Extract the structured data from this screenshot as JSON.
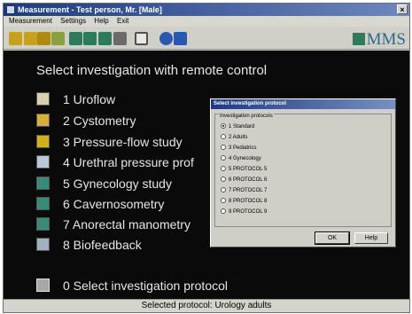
{
  "window": {
    "title": "Measurement - Test person, Mr. [Male]",
    "close_glyph": "×"
  },
  "menu": [
    "Measurement",
    "Settings",
    "Help",
    "Exit"
  ],
  "toolbar": {
    "icons": [
      {
        "name": "uroflow-tool-icon",
        "color": "#c8a020"
      },
      {
        "name": "cystometry-tool-icon",
        "color": "#c8a020"
      },
      {
        "name": "pressure-flow-tool-icon",
        "color": "#b08a10"
      },
      {
        "name": "urethral-tool-icon",
        "color": "#8aa040"
      },
      {
        "name": "gynecology-tool-icon",
        "color": "#2e7a5c"
      },
      {
        "name": "cavernosometry-tool-icon",
        "color": "#2e7a5c"
      },
      {
        "name": "anorectal-tool-icon",
        "color": "#2e7a5c"
      },
      {
        "name": "biofeedback-tool-icon",
        "color": "#6b6b6b"
      },
      {
        "name": "monitor-tool-icon",
        "color": "#505050"
      },
      {
        "name": "circle-tool-icon",
        "color": "#2a58b0"
      },
      {
        "name": "cursor-tool-icon",
        "color": "#2a58b0"
      }
    ],
    "logo": "MMS"
  },
  "main": {
    "heading": "Select investigation with remote control",
    "items": [
      {
        "label": "1 Uroflow",
        "icon": "uroflow-icon",
        "color": "#d8d0b0"
      },
      {
        "label": "2 Cystometry",
        "icon": "cystometry-icon",
        "color": "#d8b030"
      },
      {
        "label": "3 Pressure-flow study",
        "icon": "pressure-flow-icon",
        "color": "#d0b020"
      },
      {
        "label": "4 Urethral pressure prof",
        "icon": "urethral-pressure-icon",
        "color": "#b8c8d8"
      },
      {
        "label": "5 Gynecology study",
        "icon": "gynecology-icon",
        "color": "#3a8a7a"
      },
      {
        "label": "6 Cavernosometry",
        "icon": "cavernosometry-icon",
        "color": "#3a8a7a"
      },
      {
        "label": "7 Anorectal manometry",
        "icon": "anorectal-icon",
        "color": "#3a8a7a"
      },
      {
        "label": "8 Biofeedback",
        "icon": "biofeedback-icon",
        "color": "#a0b0c0"
      }
    ],
    "select_protocol": {
      "label": "0 Select investigation protocol",
      "icon": "protocol-icon",
      "color": "#a8a8a8"
    }
  },
  "dialog": {
    "title": "Select investigation protocol",
    "group_label": "Investigation protocols",
    "options": [
      "1 Standard",
      "2 Adults",
      "3 Pediatrics",
      "4 Gynecology",
      "5 PROTOCOL 5",
      "6 PROTOCOL 6",
      "7 PROTOCOL 7",
      "8 PROTOCOL 8",
      "9 PROTOCOL 9"
    ],
    "selected_index": 0,
    "ok_label": "OK",
    "help_label": "Help"
  },
  "status": {
    "text": "Selected protocol: Urology adults"
  }
}
